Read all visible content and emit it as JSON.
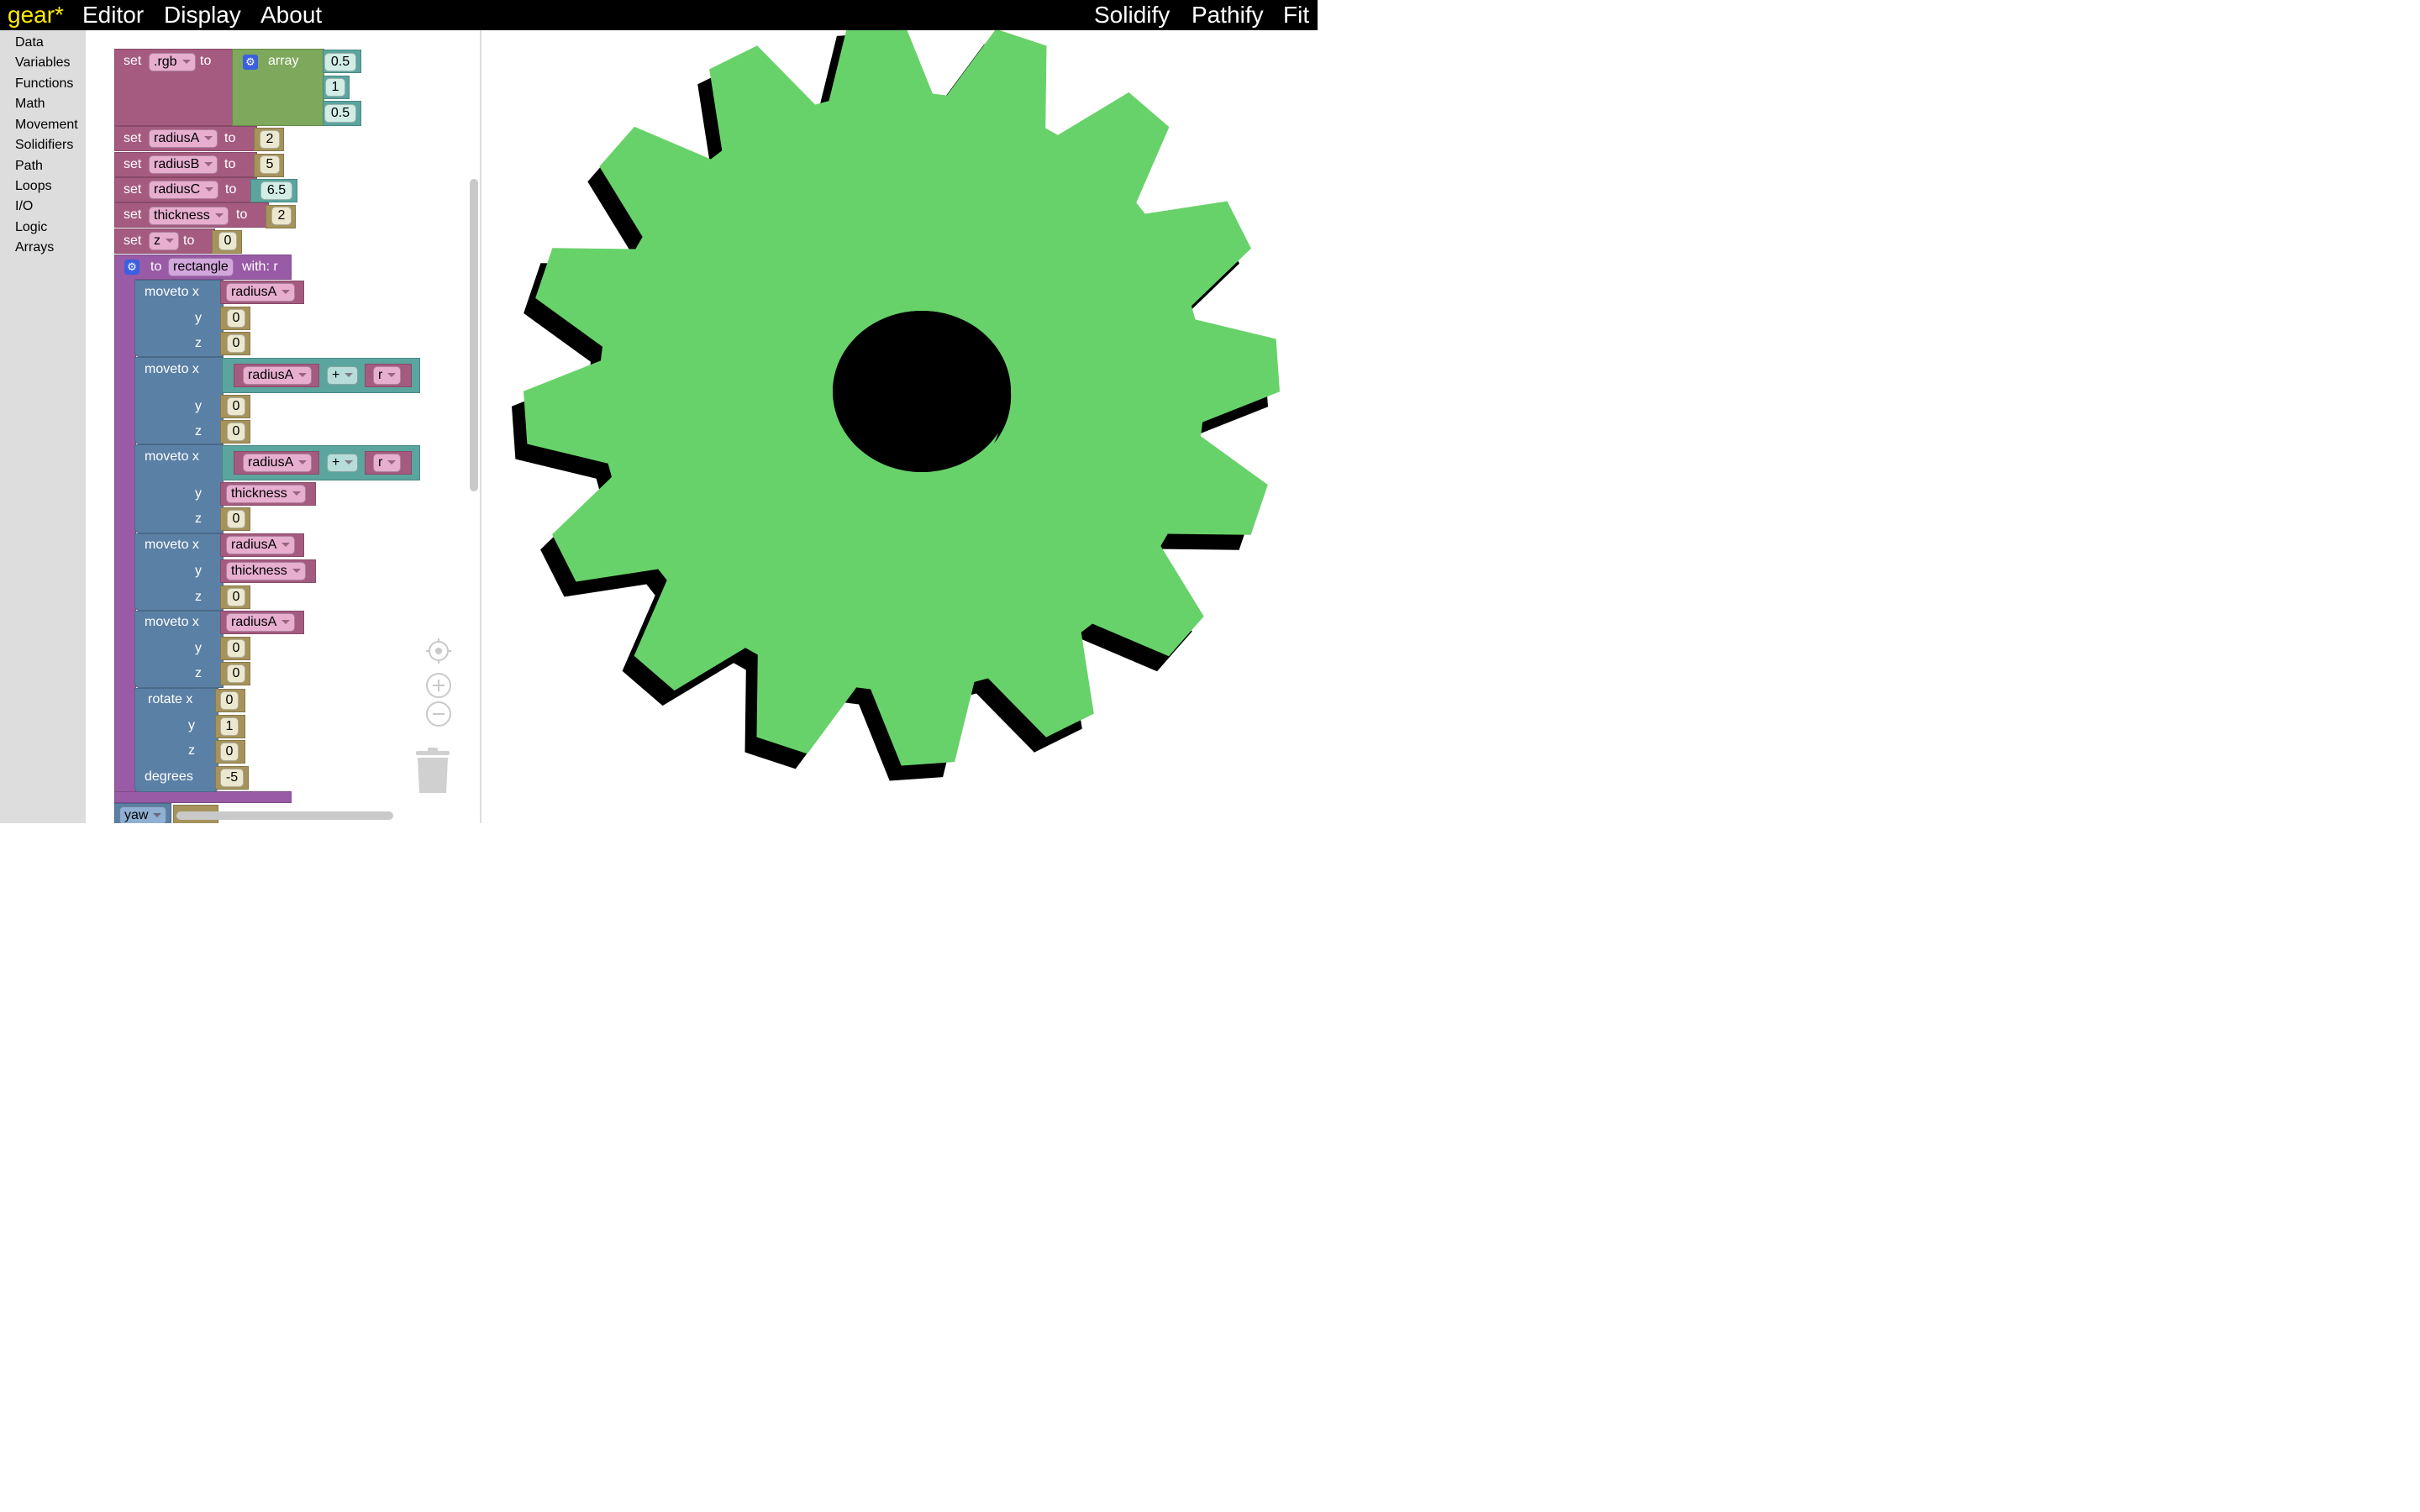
{
  "menu": {
    "app_title": "gear*",
    "editor": "Editor",
    "display": "Display",
    "about": "About",
    "solidify": "Solidify",
    "pathify": "Pathify",
    "fit": "Fit"
  },
  "toolbox": [
    "Data",
    "Variables",
    "Functions",
    "Math",
    "Movement",
    "Solidifiers",
    "Path",
    "Loops",
    "I/O",
    "Logic",
    "Arrays"
  ],
  "blocks": {
    "set": "set",
    "to": "to",
    "rgb_var": ".rgb",
    "array": "array",
    "rgb_values": [
      "0.5",
      "1",
      "0.5"
    ],
    "radiusA": "radiusA",
    "radiusA_val": "2",
    "radiusB": "radiusB",
    "radiusB_val": "5",
    "radiusC": "radiusC",
    "radiusC_val": "6.5",
    "thickness": "thickness",
    "thickness_val": "2",
    "z": "z",
    "z_val": "0",
    "func_to": "to",
    "func_name": "rectangle",
    "func_with": "with: r",
    "moveto_x": "moveto x",
    "y": "y",
    "zl": "z",
    "plus": "+",
    "r": "r",
    "zero": "0",
    "one": "1",
    "rotate_x": "rotate x",
    "degrees": "degrees",
    "degrees_val": "-5",
    "yaw": "yaw"
  },
  "display": {
    "gear_color": "#68d26a",
    "shadow_color": "#000000",
    "teeth": 16
  }
}
